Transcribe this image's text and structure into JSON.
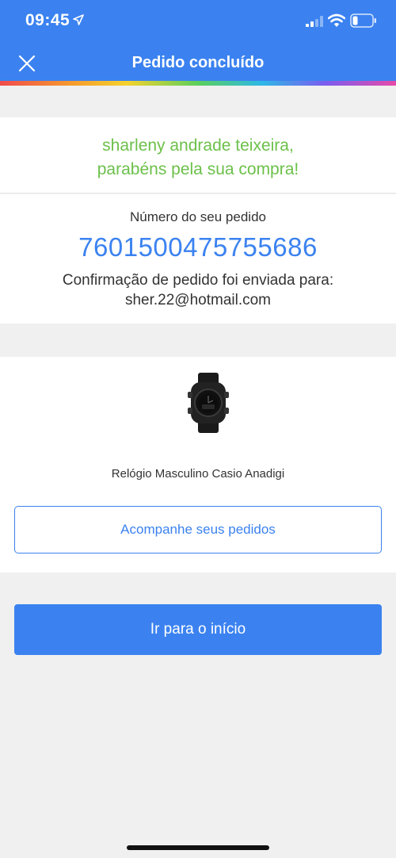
{
  "status_bar": {
    "time": "09:45"
  },
  "nav": {
    "title": "Pedido concluído"
  },
  "congrats": {
    "line1": "sharleny andrade teixeira,",
    "line2": "parabéns pela sua compra!"
  },
  "order": {
    "label": "Número do seu pedido",
    "number": "7601500475755686",
    "confirmation_label": "Confirmação de pedido foi enviada para:",
    "email": "sher.22@hotmail.com"
  },
  "product": {
    "name": "Relógio Masculino Casio Anadigi"
  },
  "buttons": {
    "track": "Acompanhe seus pedidos",
    "home": "Ir para o início"
  },
  "colors": {
    "primary": "#3b82f0",
    "success": "#6cc04a",
    "background": "#f0f0f0"
  },
  "icons": {
    "close": "close-icon",
    "location": "location-arrow-icon",
    "signal": "cellular-signal-icon",
    "wifi": "wifi-icon",
    "battery": "battery-icon"
  }
}
